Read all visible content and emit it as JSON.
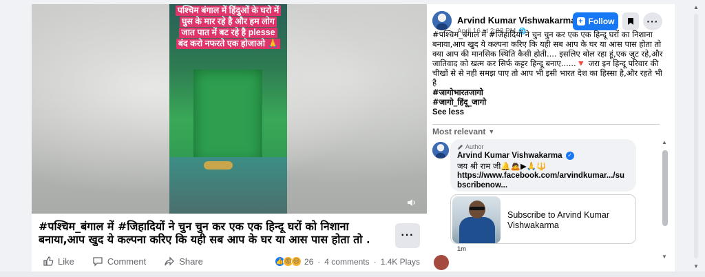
{
  "video": {
    "caption_lines": [
      "पश्चिम बंगाल में हिंदुओं के घरो में",
      "घुस के मार रहे है और हम लोग",
      "जात पात में बट रहे है plesse",
      "बंद करो नफरते एक होजाओ 🙏"
    ]
  },
  "post": {
    "text_line1": "#पश्चिम_बंगाल में #जिहादियों ने चुन चुन कर एक एक हिन्दू घरों को निशाना",
    "text_line2": "बनाया,आप खुद ये कल्पना करिए कि यही सब आप के घर या आस पास होता तो ...",
    "more_label": "···"
  },
  "actions": {
    "like": "Like",
    "comment": "Comment",
    "share": "Share"
  },
  "stats": {
    "reaction_count": "26",
    "comments": "4 comments",
    "plays": "1.4K Plays"
  },
  "side": {
    "author": "Arvind Kumar Vishwakarma",
    "date": "April 16 at 2:03 PM",
    "follow": "Follow",
    "body_lines": [
      "#पश्चिम_बंगाल में #जिहादियों ने चुन चुन कर एक एक हिन्दू घरों का निशाना",
      "बनाया,आप खुद ये कल्पना करिए कि यही सब आप के घर या आस पास होता तो",
      "क्या आप की मानसिक स्थिति कैसी होती.... इसलिए बोल रहा हूं,एक जुट रहे,और",
      "जातिवाद को खत्म कर सिर्फ कट्टर हिन्दू बनाए......🔻 जरा इन हिन्दू परिवार की",
      "चीखों से से नही समझ पाए तो आप भी इसी भारत देश का हिस्सा है,और रहते भी",
      "है"
    ],
    "hashtag1": "#जागोभारतजागो",
    "hashtag2": "#जागो_हिंदू_जागो",
    "see_less": "See less",
    "most_relevant": "Most relevant"
  },
  "comment": {
    "badge": "Author",
    "name": "Arvind Kumar Vishwakarma",
    "text": "जय श्री राम जी🔔🙇▶🙏🔱",
    "link": "https://www.facebook.com/arvindkumar.../subscribenow...",
    "preview_title": "Subscribe to Arvind Kumar Vishwakarma",
    "time": "1m"
  },
  "colors": {
    "accent": "#1877f2",
    "caption_bg": "#e0356a",
    "muted": "#65676b"
  }
}
